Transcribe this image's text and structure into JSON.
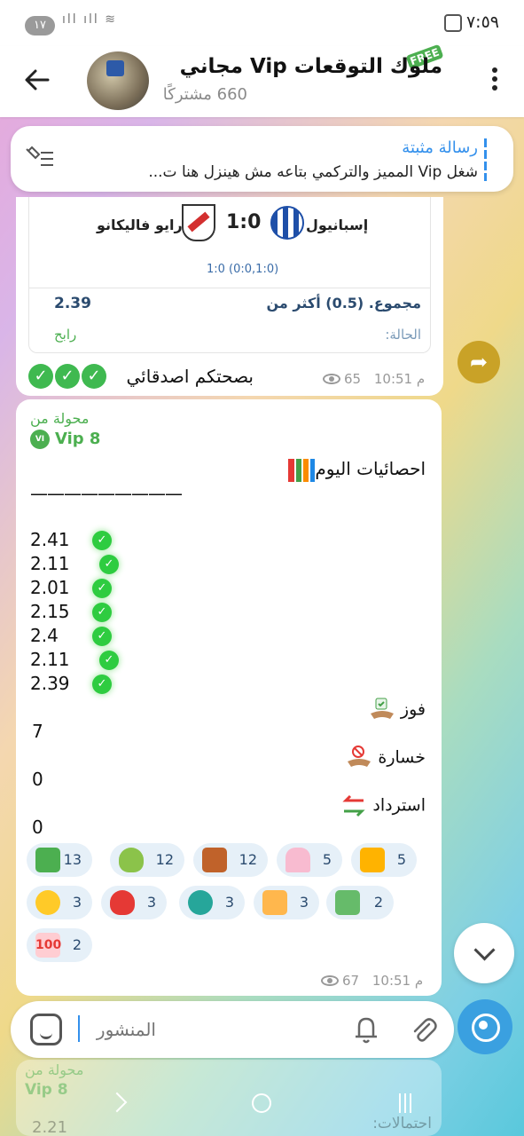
{
  "statusbar": {
    "time": "٧:٥٩",
    "badge": "١٧"
  },
  "header": {
    "title": "ملوك التوقعات Vip مجاني",
    "subtitle": "660 مشتركًا",
    "free_badge": "FREE"
  },
  "pinned": {
    "title": "رسالة مثبتة",
    "text": "شغل Vip المميز والتركمي بتاعه مش هينزل هنا ت..."
  },
  "bubble1": {
    "team_home": "إسبانيول",
    "team_away": "رايو فاليكانو",
    "score": "1:0",
    "halftime": "1:0 (0:0,1:0)",
    "bet_label": "مجموع. (0.5) أكثر من",
    "bet_odd": "2.39",
    "status_label": "الحالة:",
    "status_value": "رابح",
    "caption": "بصحتكم اصدقائي",
    "views": "65",
    "time": "10:51 م"
  },
  "bubble2": {
    "forwarded_label": "محولة من",
    "forwarded_from": "Vip 8",
    "badge": "VI",
    "stats_title": "احصائيات اليوم",
    "dashes": "—————————",
    "odds": [
      "2.41",
      "2.11",
      "2.01",
      "2.15",
      "2.4",
      "2.11",
      "2.39"
    ],
    "win_label": "فوز",
    "win_count": "7",
    "loss_label": "خسارة",
    "loss_count": "0",
    "refund_label": "استرداد",
    "refund_count": "0",
    "views": "67",
    "time": "10:51 م",
    "reactions": [
      {
        "icon": "money-icon",
        "count": "13",
        "color": "#4caf50"
      },
      {
        "icon": "money-bag-icon",
        "count": "12",
        "color": "#8bc34a"
      },
      {
        "icon": "wallet-icon",
        "count": "12",
        "color": "#c0622a"
      },
      {
        "icon": "champagne-icon",
        "count": "5",
        "color": "#f48fb1"
      },
      {
        "icon": "200-icon",
        "count": "5",
        "color": "#ff9800"
      },
      {
        "icon": "heart-eyes-icon",
        "count": "3",
        "color": "#ffca28"
      },
      {
        "icon": "kiss-icon",
        "count": "3",
        "color": "#e53935"
      },
      {
        "icon": "currency-exchange-icon",
        "count": "3",
        "color": "#26a69a"
      },
      {
        "icon": "thumbs-up-icon",
        "count": "3",
        "color": "#ffb74d"
      },
      {
        "icon": "money-hand-icon",
        "count": "2",
        "color": "#66bb6a"
      },
      {
        "icon": "hundred-icon",
        "count": "2",
        "color": "#e53935"
      }
    ]
  },
  "input": {
    "placeholder": "المنشور"
  },
  "ghost": {
    "forwarded_label": "محولة من",
    "forwarded_from": "Vip 8",
    "odd": "2.21",
    "label": "احتمالات:"
  }
}
